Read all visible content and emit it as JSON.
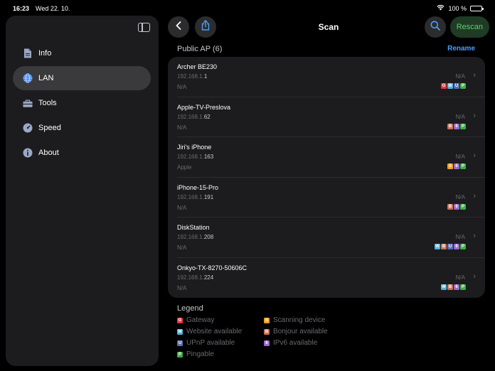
{
  "status_bar": {
    "time": "16:23",
    "date": "Wed 22. 10.",
    "battery": "100 %"
  },
  "sidebar": {
    "items": [
      {
        "label": "Info",
        "icon": "document-icon",
        "active": false
      },
      {
        "label": "LAN",
        "icon": "globe-icon",
        "active": true
      },
      {
        "label": "Tools",
        "icon": "toolbox-icon",
        "active": false
      },
      {
        "label": "Speed",
        "icon": "speedometer-icon",
        "active": false
      },
      {
        "label": "About",
        "icon": "info-icon",
        "active": false
      }
    ]
  },
  "toolbar": {
    "title": "Scan",
    "rescan_label": "Rescan"
  },
  "section": {
    "header": "Public AP (6)",
    "rename_label": "Rename"
  },
  "devices": [
    {
      "name": "Archer BE230",
      "ip_prefix": "192.168.1.",
      "ip_suffix": "1",
      "vendor": "N/A",
      "right": "N/A",
      "badges": [
        "G",
        "W",
        "U",
        "P"
      ]
    },
    {
      "name": "Apple-TV-Preslova",
      "ip_prefix": "192.168.1.",
      "ip_suffix": "62",
      "vendor": "N/A",
      "right": "N/A",
      "badges": [
        "B",
        "6",
        "P"
      ]
    },
    {
      "name": "Jiri's iPhone",
      "ip_prefix": "192.168.1.",
      "ip_suffix": "163",
      "vendor": "Apple",
      "right": "N/A",
      "badges": [
        "S",
        "6",
        "P"
      ]
    },
    {
      "name": "iPhone-15-Pro",
      "ip_prefix": "192.168.1.",
      "ip_suffix": "191",
      "vendor": "N/A",
      "right": "N/A",
      "badges": [
        "B",
        "6",
        "P"
      ]
    },
    {
      "name": "DiskStation",
      "ip_prefix": "192.168.1.",
      "ip_suffix": "208",
      "vendor": "N/A",
      "right": "N/A",
      "badges": [
        "W",
        "B",
        "U",
        "6",
        "P"
      ]
    },
    {
      "name": "Onkyo-TX-8270-50606C",
      "ip_prefix": "192.168.1.",
      "ip_suffix": "224",
      "vendor": "N/A",
      "right": "N/A",
      "badges": [
        "W",
        "B",
        "6",
        "P"
      ]
    }
  ],
  "legend": {
    "title": "Legend",
    "items": [
      {
        "key": "G",
        "label": "Gateway",
        "color": "#e5373a"
      },
      {
        "key": "W",
        "label": "Website available",
        "color": "#4fb3d9"
      },
      {
        "key": "U",
        "label": "UPnP available",
        "color": "#5b6fb5"
      },
      {
        "key": "P",
        "label": "Pingable",
        "color": "#3fae4a"
      },
      {
        "key": "S",
        "label": "Scanning device",
        "color": "#f0a020"
      },
      {
        "key": "B",
        "label": "Bonjour available",
        "color": "#c9735a"
      },
      {
        "key": "6",
        "label": "IPv6 available",
        "color": "#9a6bc8"
      }
    ]
  },
  "colors": {
    "accent": "#4a9eff",
    "rescan": "#5fd068",
    "background": "#000000",
    "panel": "#1c1c1e"
  }
}
